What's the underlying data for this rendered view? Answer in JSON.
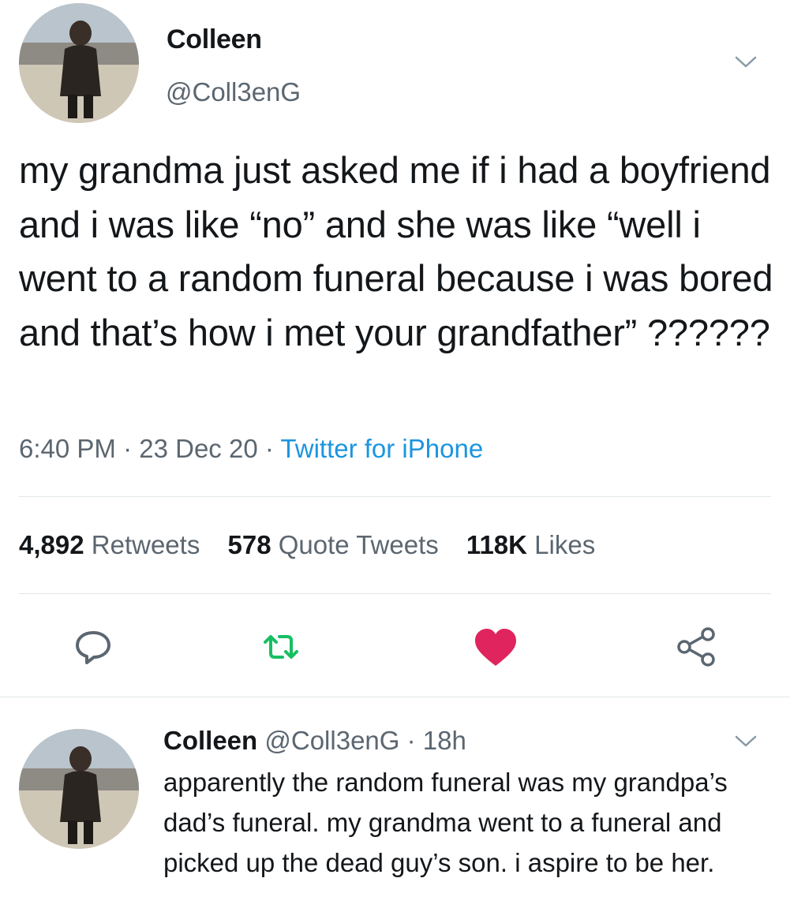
{
  "tweet": {
    "display_name": "Colleen",
    "handle": "@Coll3enG",
    "text": "my grandma just asked me if i had a boyfriend and i was like “no” and she was like “well i went to a random funeral because i was bored and that’s how i met your grandfather” ??????",
    "time": "6:40 PM",
    "sep1": " · ",
    "date": "23 Dec 20",
    "sep2": " · ",
    "source": "Twitter for iPhone",
    "stats": {
      "retweets_count": "4,892",
      "retweets_label": "Retweets",
      "quotes_count": "578",
      "quotes_label": "Quote Tweets",
      "likes_count": "118K",
      "likes_label": "Likes"
    },
    "actions": {
      "reply_icon": "reply-icon",
      "retweet_icon": "retweet-icon",
      "like_icon": "heart-icon",
      "share_icon": "share-icon"
    },
    "colors": {
      "retweet": "#17bf63",
      "like": "#e0245e",
      "link": "#1b95e0",
      "muted": "#5b6670"
    }
  },
  "reply": {
    "display_name": "Colleen",
    "handle": "@Coll3enG",
    "separator": " · ",
    "age": "18h",
    "text": "apparently the random funeral was my grandpa’s dad’s funeral. my grandma went to a funeral and picked up the dead guy’s son. i aspire to be her."
  }
}
